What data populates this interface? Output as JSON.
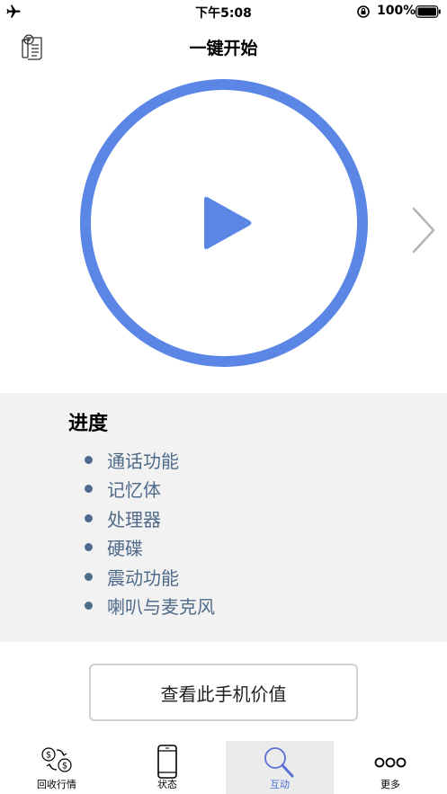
{
  "status_bar": {
    "time": "下午5:08",
    "battery": "100%",
    "airplane_icon": "airplane-icon",
    "lock_icon": "orientation-lock-icon",
    "battery_icon": "battery-icon"
  },
  "nav": {
    "title": "一键开始",
    "left_icon": "document-icon"
  },
  "start": {
    "icon": "play-icon",
    "accent": "#5b86e5",
    "next_icon": "chevron-right-icon"
  },
  "progress": {
    "heading": "进度",
    "items": [
      {
        "label": "通话功能"
      },
      {
        "label": "记忆体"
      },
      {
        "label": "处理器"
      },
      {
        "label": "硬碟"
      },
      {
        "label": "震动功能"
      },
      {
        "label": "喇叭与麦克风"
      }
    ],
    "text_color": "#4f6b8a"
  },
  "value_button": {
    "label": "查看此手机价值"
  },
  "tabs": [
    {
      "label": "回收行情",
      "icon": "currency-exchange-icon",
      "active": false
    },
    {
      "label": "状态",
      "icon": "phone-icon",
      "active": false
    },
    {
      "label": "互动",
      "icon": "search-icon",
      "active": true
    },
    {
      "label": "更多",
      "icon": "more-icon",
      "active": false
    }
  ]
}
